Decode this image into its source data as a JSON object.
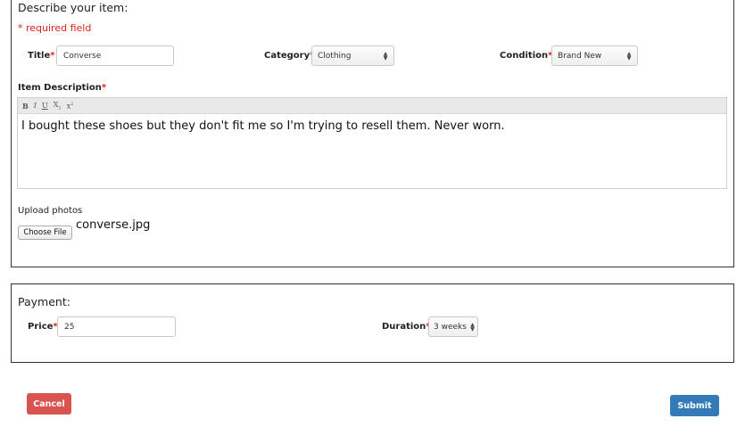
{
  "describe": {
    "heading": "Describe your item:",
    "required_note": "* required field",
    "title": {
      "label": "Title",
      "value": "Converse"
    },
    "category": {
      "label": "Category",
      "selected": "Clothing"
    },
    "condition": {
      "label": "Condition",
      "selected": "Brand New"
    },
    "description": {
      "label": "Item Description",
      "toolbar": {
        "bold": "B",
        "italic": "I",
        "underline": "U",
        "subscript": "X",
        "superscript": "x"
      },
      "text": "I bought these shoes but they don't fit me so I'm trying to resell them. Never worn."
    },
    "upload": {
      "label": "Upload photos",
      "button": "Choose File",
      "file_name": "converse.jpg"
    }
  },
  "payment": {
    "heading": "Payment:",
    "price": {
      "label": "Price",
      "value": "25"
    },
    "duration": {
      "label": "Duration",
      "selected": "3 weeks"
    }
  },
  "actions": {
    "cancel": "Cancel",
    "submit": "Submit"
  },
  "colors": {
    "required": "#e0201a",
    "cancel": "#d9534f",
    "submit": "#337ab7"
  }
}
